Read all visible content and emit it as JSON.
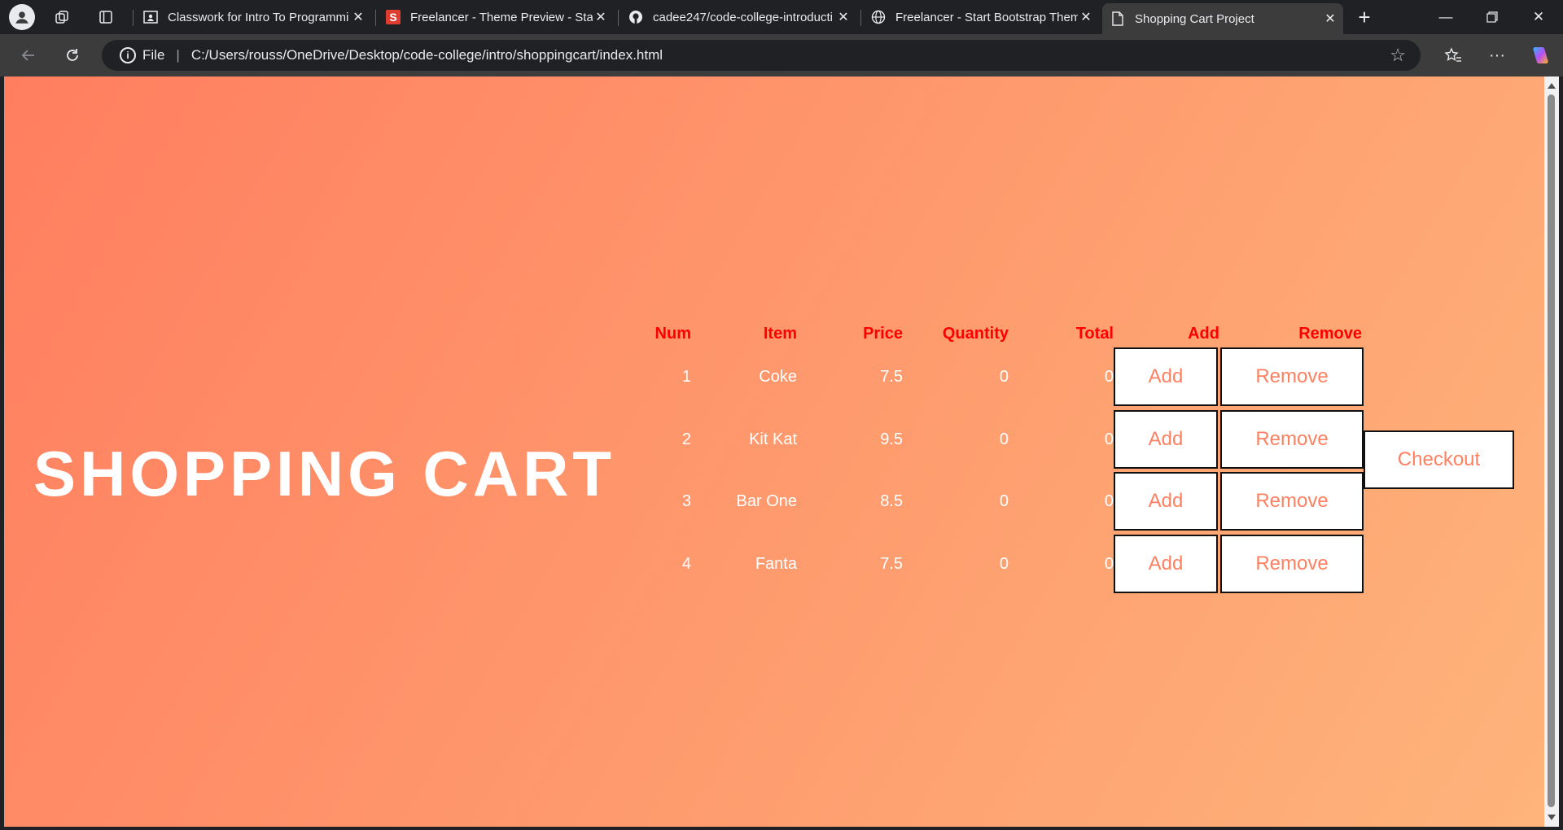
{
  "browser": {
    "tabs": [
      {
        "title": "Classwork for Intro To Programmi",
        "icon": "classroom-icon"
      },
      {
        "title": "Freelancer - Theme Preview - Star",
        "icon": "startbootstrap-icon"
      },
      {
        "title": "cadee247/code-college-introducti",
        "icon": "github-icon"
      },
      {
        "title": "Freelancer - Start Bootstrap Them",
        "icon": "globe-icon"
      },
      {
        "title": "Shopping Cart Project",
        "icon": "page-icon",
        "active": true
      }
    ],
    "address": {
      "scheme": "File",
      "url": "C:/Users/rouss/OneDrive/Desktop/code-college/intro/shoppingcart/index.html"
    }
  },
  "page": {
    "headline": "SHOPPING CART",
    "columns": [
      "Num",
      "Item",
      "Price",
      "Quantity",
      "Total",
      "Add",
      "Remove"
    ],
    "rows": [
      {
        "num": "1",
        "item": "Coke",
        "price": "7.5",
        "quantity": "0",
        "total": "0"
      },
      {
        "num": "2",
        "item": "Kit Kat",
        "price": "9.5",
        "quantity": "0",
        "total": "0"
      },
      {
        "num": "3",
        "item": "Bar One",
        "price": "8.5",
        "quantity": "0",
        "total": "0"
      },
      {
        "num": "4",
        "item": "Fanta",
        "price": "7.5",
        "quantity": "0",
        "total": "0"
      }
    ],
    "add_label": "Add",
    "remove_label": "Remove",
    "checkout_label": "Checkout"
  },
  "colors": {
    "gradient_start": "#ff7e5f",
    "gradient_end": "#feb47b",
    "header_text": "#ff0000",
    "button_text": "#ff8060"
  }
}
